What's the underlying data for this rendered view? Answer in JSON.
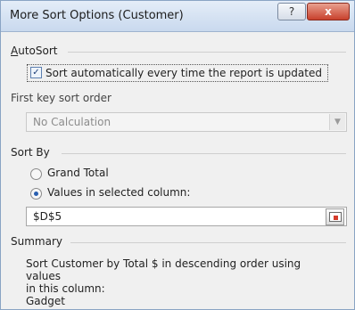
{
  "window": {
    "title": "More Sort Options (Customer)",
    "help_glyph": "?",
    "close_glyph": "x"
  },
  "autosort": {
    "section_title": "AutoSort",
    "checkbox_label": "Sort automatically every time the report is updated",
    "checked": true
  },
  "first_key": {
    "section_title": "First key sort order",
    "dropdown_value": "No Calculation",
    "enabled": false
  },
  "sort_by": {
    "section_title": "Sort By",
    "option_grand_total": "Grand Total",
    "option_values": "Values in selected column:",
    "selected": "values",
    "reference": "$D$5"
  },
  "summary": {
    "section_title": "Summary",
    "text_line1": "Sort Customer by Total $ in descending order using values",
    "text_line2": "in this column:",
    "text_line3": "Gadget"
  }
}
